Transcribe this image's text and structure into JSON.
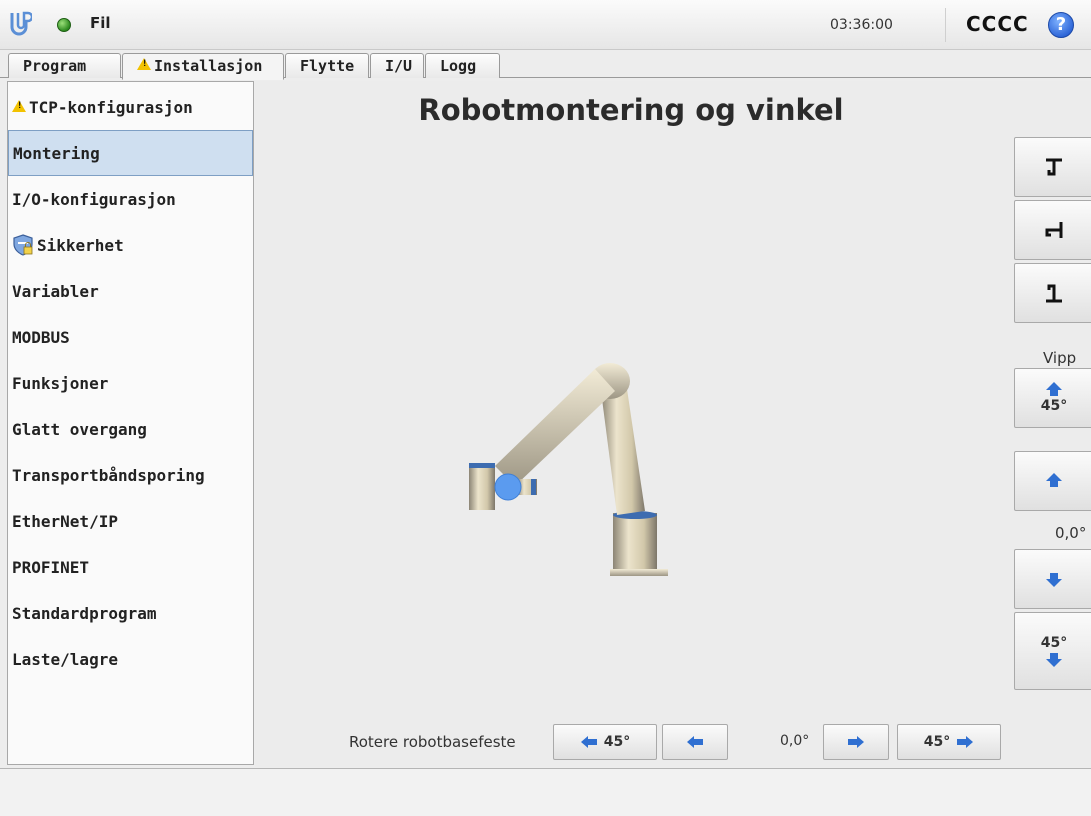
{
  "header": {
    "file_label": "Fil",
    "clock": "03:36:00",
    "robot_name": "CCCC",
    "help_symbol": "?"
  },
  "tabs": [
    {
      "label": "Program",
      "active": false
    },
    {
      "label": "Installasjon",
      "active": true,
      "warning": true
    },
    {
      "label": "Flytte",
      "active": false
    },
    {
      "label": "I/U",
      "active": false
    },
    {
      "label": "Logg",
      "active": false
    }
  ],
  "sidebar": {
    "items": [
      {
        "label": "TCP-konfigurasjon",
        "icon": "warning-icon"
      },
      {
        "label": "Montering",
        "active": true
      },
      {
        "label": "I/O-konfigurasjon"
      },
      {
        "label": "Sikkerhet",
        "icon": "shield-icon"
      },
      {
        "label": "Variabler"
      },
      {
        "label": "MODBUS"
      },
      {
        "label": "Funksjoner"
      },
      {
        "label": "Glatt overgang"
      },
      {
        "label": "Transportbåndsporing"
      },
      {
        "label": "EtherNet/IP"
      },
      {
        "label": "PROFINET"
      },
      {
        "label": "Standardprogram"
      },
      {
        "label": "Laste/lagre"
      }
    ]
  },
  "main": {
    "title": "Robotmontering og vinkel",
    "tilt": {
      "label": "Vipp",
      "value": "0,0°",
      "up45_label": "45°",
      "down45_label": "45°"
    },
    "rotate": {
      "label": "Rotere robotbasefeste",
      "left45_label": "45°",
      "right45_label": "45°",
      "value": "0,0°"
    }
  },
  "colors": {
    "accent_blue": "#2f6fd1",
    "selected_bg": "#cfdff0",
    "warning_yellow": "#f2c200",
    "status_green": "#2d8a1f"
  }
}
